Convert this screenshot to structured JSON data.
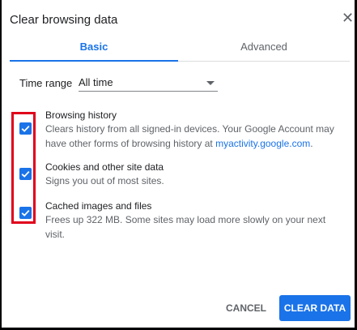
{
  "dialog": {
    "title": "Clear browsing data",
    "close_symbol": "✕"
  },
  "tabs": [
    {
      "label": "Basic",
      "active": true
    },
    {
      "label": "Advanced",
      "active": false
    }
  ],
  "time_range": {
    "label": "Time range",
    "value": "All time"
  },
  "options": [
    {
      "title": "Browsing history",
      "desc_prefix": "Clears history from all signed-in devices. Your Google Account may have other forms of browsing history at ",
      "desc_link": "myactivity.google.com",
      "desc_suffix": ".",
      "checked": true
    },
    {
      "title": "Cookies and other site data",
      "desc": "Signs you out of most sites.",
      "checked": true
    },
    {
      "title": "Cached images and files",
      "desc": "Frees up 322 MB. Some sites may load more slowly on your next visit.",
      "checked": true
    }
  ],
  "buttons": {
    "cancel": "CANCEL",
    "clear": "CLEAR DATA"
  },
  "colors": {
    "accent": "#1a73e8",
    "highlight": "#e0001b"
  }
}
